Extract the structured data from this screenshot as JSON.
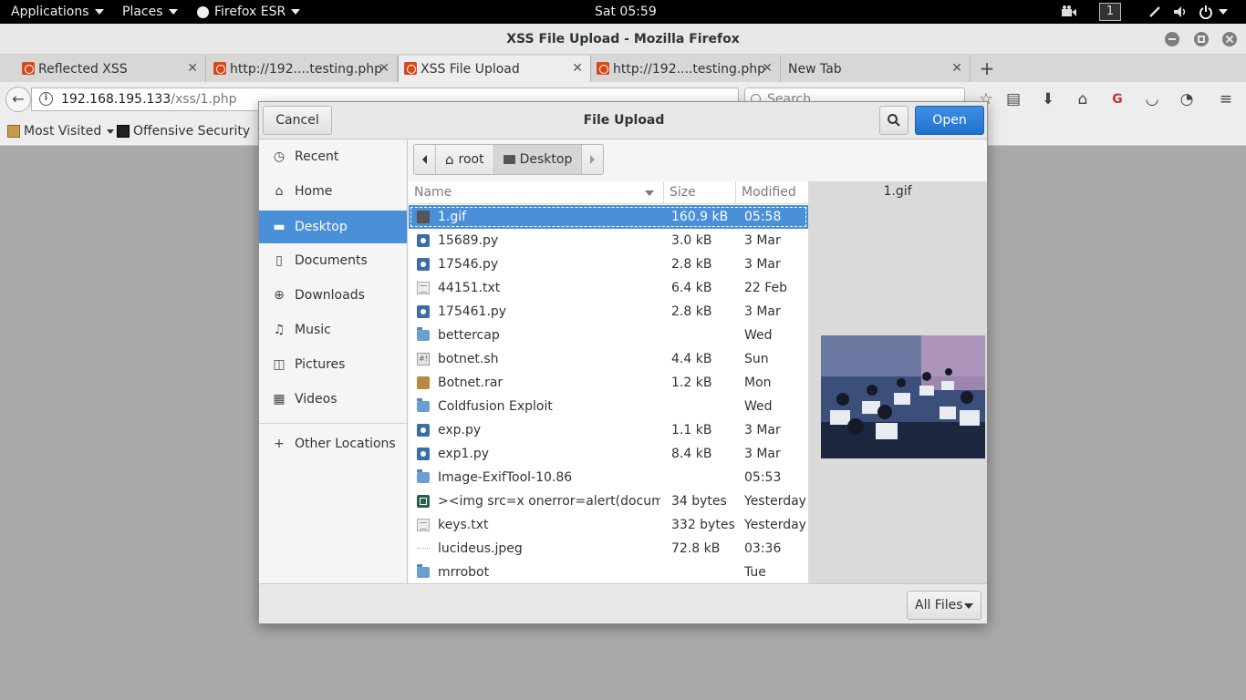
{
  "topbar": {
    "applications": "Applications",
    "places": "Places",
    "firefox": "Firefox ESR",
    "clock": "Sat 05:59",
    "workspace": "1"
  },
  "window": {
    "title": "XSS File Upload - Mozilla Firefox"
  },
  "tabs": [
    {
      "label": "Reflected XSS"
    },
    {
      "label": "http://192....testing.php"
    },
    {
      "label": "XSS File Upload"
    },
    {
      "label": "http://192....testing.php"
    },
    {
      "label": "New Tab"
    }
  ],
  "navbar": {
    "url_host": "192.168.195.133",
    "url_path": "/xss/1.php",
    "search_placeholder": "Search"
  },
  "bookmarks": {
    "most_visited": "Most Visited",
    "offensive_security": "Offensive Security"
  },
  "dialog": {
    "title": "File Upload",
    "cancel": "Cancel",
    "open": "Open",
    "filter": "All Files",
    "sidebar": [
      {
        "label": "Recent",
        "icon": "clock-icon"
      },
      {
        "label": "Home",
        "icon": "home-icon"
      },
      {
        "label": "Desktop",
        "icon": "folder-icon"
      },
      {
        "label": "Documents",
        "icon": "document-icon"
      },
      {
        "label": "Downloads",
        "icon": "download-icon"
      },
      {
        "label": "Music",
        "icon": "music-icon"
      },
      {
        "label": "Pictures",
        "icon": "camera-icon"
      },
      {
        "label": "Videos",
        "icon": "film-icon"
      },
      {
        "label": "Other Locations",
        "icon": "plus-icon"
      }
    ],
    "path": {
      "root": "root",
      "current": "Desktop"
    },
    "columns": {
      "name": "Name",
      "size": "Size",
      "modified": "Modified"
    },
    "files": [
      {
        "name": "1.gif",
        "size": "160.9 kB",
        "modified": "05:58",
        "type": "img"
      },
      {
        "name": "15689.py",
        "size": "3.0 kB",
        "modified": "3 Mar",
        "type": "py"
      },
      {
        "name": "17546.py",
        "size": "2.8 kB",
        "modified": "3 Mar",
        "type": "py"
      },
      {
        "name": "44151.txt",
        "size": "6.4 kB",
        "modified": "22 Feb",
        "type": "txt"
      },
      {
        "name": "175461.py",
        "size": "2.8 kB",
        "modified": "3 Mar",
        "type": "py"
      },
      {
        "name": "bettercap",
        "size": "",
        "modified": "Wed",
        "type": "folder"
      },
      {
        "name": "botnet.sh",
        "size": "4.4 kB",
        "modified": "Sun",
        "type": "sh"
      },
      {
        "name": "Botnet.rar",
        "size": "1.2 kB",
        "modified": "Mon",
        "type": "rar"
      },
      {
        "name": "Coldfusion Exploit",
        "size": "",
        "modified": "Wed",
        "type": "folder"
      },
      {
        "name": "exp.py",
        "size": "1.1 kB",
        "modified": "3 Mar",
        "type": "py"
      },
      {
        "name": "exp1.py",
        "size": "8.4 kB",
        "modified": "3 Mar",
        "type": "py"
      },
      {
        "name": "Image-ExifTool-10.86",
        "size": "",
        "modified": "05:53",
        "type": "folder"
      },
      {
        "name": "><img src=x onerror=alert(documen…",
        "size": "34 bytes",
        "modified": "Yesterday",
        "type": "html"
      },
      {
        "name": "keys.txt",
        "size": "332 bytes",
        "modified": "Yesterday",
        "type": "txt"
      },
      {
        "name": "lucideus.jpeg",
        "size": "72.8 kB",
        "modified": "03:36",
        "type": "jpeg"
      },
      {
        "name": "mrrobot",
        "size": "",
        "modified": "Tue",
        "type": "folder"
      }
    ],
    "preview_name": "1.gif"
  },
  "colors": {
    "accent": "#4a90d9",
    "open_button": "#2a7fd8",
    "topbar": "#000000",
    "favicon": "#d8491a"
  }
}
